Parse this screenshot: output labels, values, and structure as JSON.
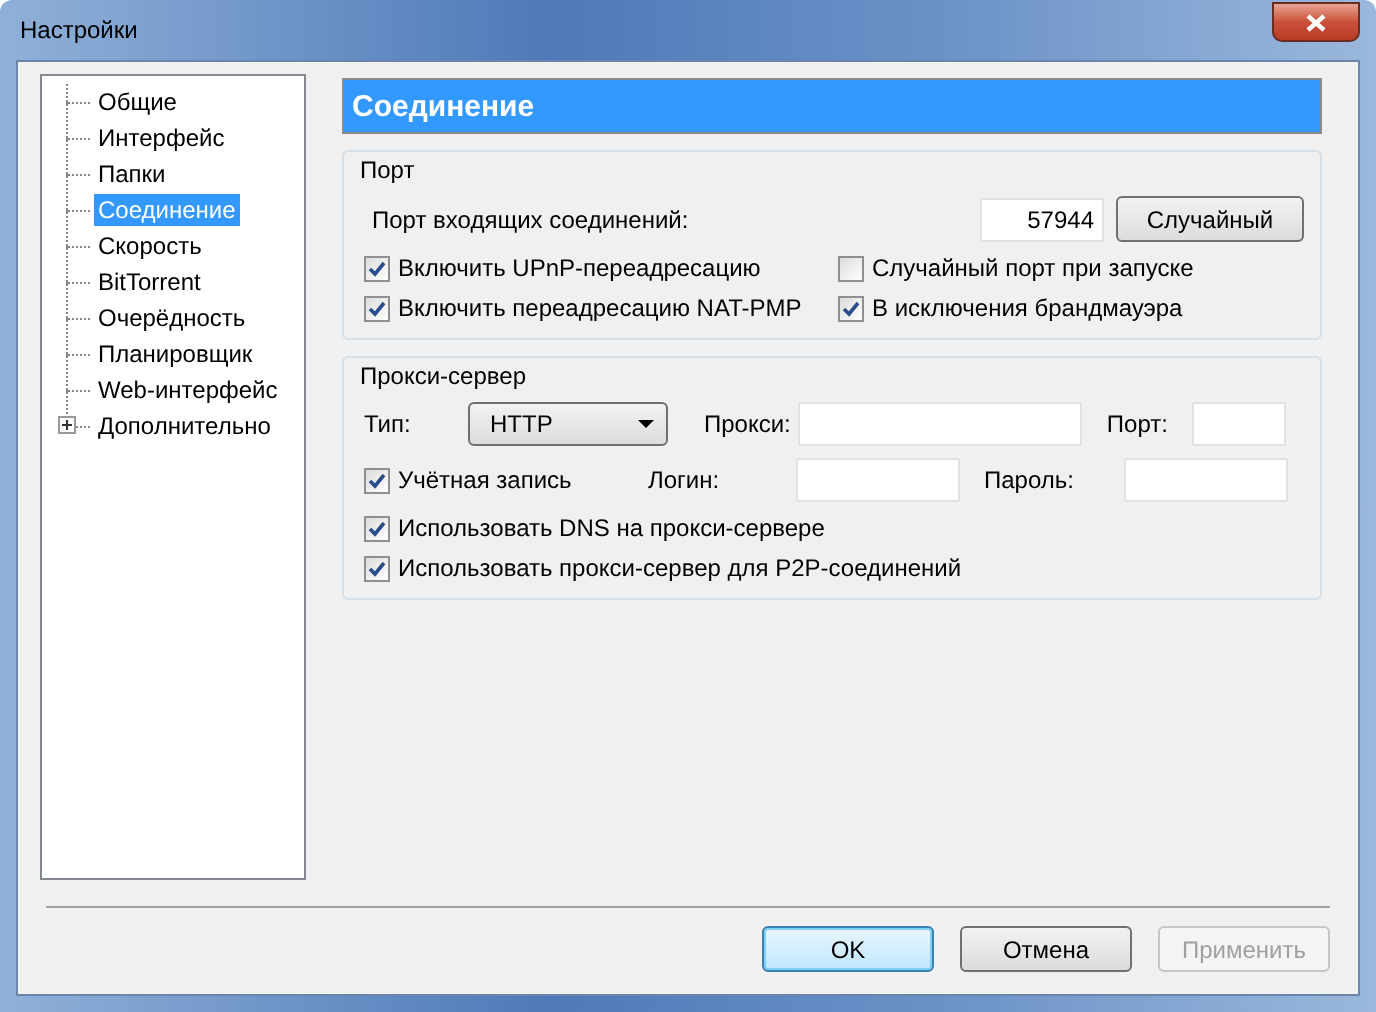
{
  "window": {
    "title": "Настройки"
  },
  "sidebar": {
    "items": [
      {
        "label": "Общие",
        "selected": false
      },
      {
        "label": "Интерфейс",
        "selected": false
      },
      {
        "label": "Папки",
        "selected": false
      },
      {
        "label": "Соединение",
        "selected": true
      },
      {
        "label": "Скорость",
        "selected": false
      },
      {
        "label": "BitTorrent",
        "selected": false
      },
      {
        "label": "Очерёдность",
        "selected": false
      },
      {
        "label": "Планировщик",
        "selected": false
      },
      {
        "label": "Web-интерфейс",
        "selected": false
      },
      {
        "label": "Дополнительно",
        "selected": false,
        "expanded": false
      }
    ]
  },
  "page_title": "Соединение",
  "port_group": {
    "title": "Порт",
    "port_label": "Порт входящих соединений:",
    "port_value": "57944",
    "random_button": "Случайный",
    "options": [
      {
        "label": "Включить UPnP-переадресацию",
        "checked": true
      },
      {
        "label": "Случайный порт при запуске",
        "checked": false
      },
      {
        "label": "Включить переадресацию NAT-PMP",
        "checked": true
      },
      {
        "label": "В исключения брандмауэра",
        "checked": true
      }
    ]
  },
  "proxy_group": {
    "title": "Прокси-сервер",
    "type_label": "Тип:",
    "type_value": "HTTP",
    "proxy_label": "Прокси:",
    "port_label": "Порт:",
    "auth": {
      "label": "Учётная запись",
      "checked": true
    },
    "login_label": "Логин:",
    "password_label": "Пароль:",
    "options": [
      {
        "label": "Использовать DNS на прокси-сервере",
        "checked": true
      },
      {
        "label": "Использовать прокси-сервер для P2P-соединений",
        "checked": true
      }
    ]
  },
  "buttons": [
    {
      "label": "OK",
      "kind": "default"
    },
    {
      "label": "Отмена",
      "kind": "normal"
    },
    {
      "label": "Применить",
      "kind": "disabled"
    }
  ]
}
